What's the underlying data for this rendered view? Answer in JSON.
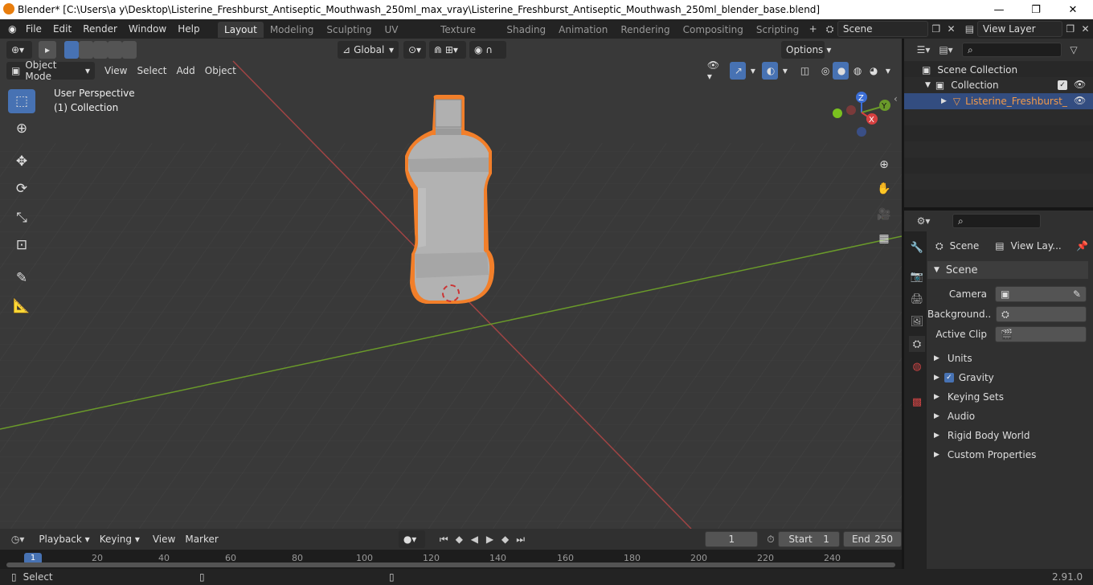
{
  "window": {
    "title": "Blender* [C:\\Users\\a y\\Desktop\\Listerine_Freshburst_Antiseptic_Mouthwash_250ml_max_vray\\Listerine_Freshburst_Antiseptic_Mouthwash_250ml_blender_base.blend]",
    "minimize": "—",
    "maximize": "❐",
    "close": "✕"
  },
  "menu": [
    "File",
    "Edit",
    "Render",
    "Window",
    "Help"
  ],
  "workspaces": [
    "Layout",
    "Modeling",
    "Sculpting",
    "UV Editing",
    "Texture Paint",
    "Shading",
    "Animation",
    "Rendering",
    "Compositing",
    "Scripting"
  ],
  "active_workspace": "Layout",
  "scene_field": "Scene",
  "view_layer_field": "View Layer",
  "viewport": {
    "mode": "Object Mode",
    "menus": [
      "View",
      "Select",
      "Add",
      "Object"
    ],
    "transform_orientation": "Global",
    "options": "Options",
    "overlay_text_1": "User Perspective",
    "overlay_text_2": "(1) Collection",
    "axes": {
      "z": "Z",
      "y": "Y",
      "x": "X"
    }
  },
  "outliner": {
    "search_placeholder": "",
    "rows": [
      "Scene Collection",
      "Collection",
      "Listerine_Freshburst_"
    ]
  },
  "properties": {
    "breadcrumb_scene": "Scene",
    "breadcrumb_view_layer": "View Lay...",
    "panel_title": "Scene",
    "fields": [
      {
        "label": "Camera"
      },
      {
        "label": "Background..."
      },
      {
        "label": "Active Clip"
      }
    ],
    "subpanels": [
      "Units",
      "Gravity",
      "Keying Sets",
      "Audio",
      "Rigid Body World",
      "Custom Properties"
    ]
  },
  "timeline": {
    "menus": [
      "Playback",
      "Keying",
      "View",
      "Marker"
    ],
    "current_frame": "1",
    "start_label": "Start",
    "start_value": "1",
    "end_label": "End",
    "end_value": "250",
    "ruler": [
      "1",
      "20",
      "40",
      "60",
      "80",
      "100",
      "120",
      "140",
      "160",
      "180",
      "200",
      "220",
      "240"
    ]
  },
  "status": {
    "left": "Select",
    "version": "2.91.0"
  },
  "colors": {
    "accent": "#4772b3",
    "selection_outline": "#f27f2a",
    "x_axis": "#b04040",
    "y_axis": "#6a9a2a"
  }
}
